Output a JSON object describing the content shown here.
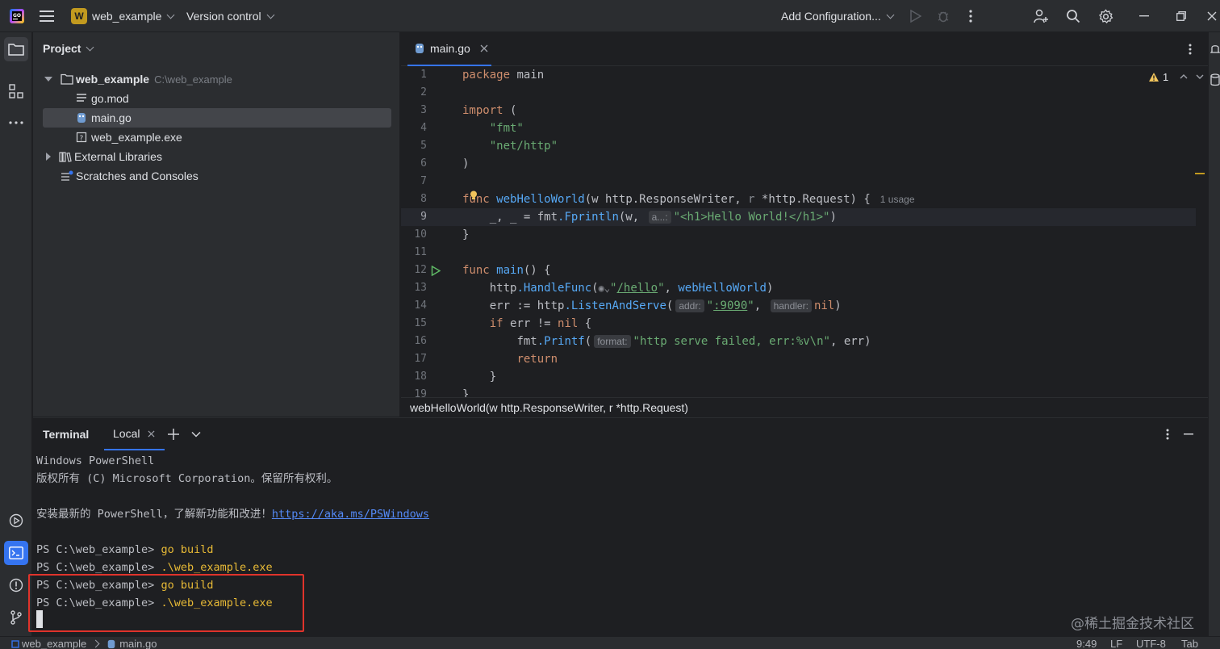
{
  "titlebar": {
    "project_initial": "W",
    "project_name": "web_example",
    "version_control": "Version control",
    "run_config": "Add Configuration..."
  },
  "project_panel": {
    "title": "Project",
    "root_name": "web_example",
    "root_path": "C:\\web_example",
    "files": [
      "go.mod",
      "main.go",
      "web_example.exe"
    ],
    "external_libraries": "External Libraries",
    "scratches": "Scratches and Consoles"
  },
  "editor": {
    "tab_label": "main.go",
    "warning_count": "1",
    "line_numbers": [
      "1",
      "2",
      "3",
      "4",
      "5",
      "6",
      "7",
      "8",
      "9",
      "10",
      "11",
      "12",
      "13",
      "14",
      "15",
      "16",
      "17",
      "18",
      "19"
    ],
    "current_line": "9",
    "breadcrumb": "webHelloWorld(w http.ResponseWriter, r *http.Request)",
    "code": {
      "l1_kw": "package",
      "l1_name": "main",
      "l3_kw": "import",
      "l3_paren": "(",
      "l4_str": "\"fmt\"",
      "l5_str": "\"net/http\"",
      "l6_paren": ")",
      "l8_kw": "func",
      "l8_fn": "webHelloWorld",
      "l8_sig1": "(w ",
      "l8_pkg1": "http",
      "l8_ty1": ".ResponseWriter",
      "l8_sig2": ", ",
      "l8_r": "r",
      "l8_sig3": " *",
      "l8_pkg2": "http",
      "l8_ty2": ".Request",
      "l8_sig4": ") {",
      "l8_usage": "1 usage",
      "l9_pre": "    _, _ = ",
      "l9_pkg": "fmt",
      "l9_call": ".Fprintln",
      "l9_args": "(w, ",
      "l9_hint": "a...:",
      "l9_str": "\"<h1>Hello World!</h1>\"",
      "l9_end": ")",
      "l10": "}",
      "l12_kw": "func",
      "l12_fn": "main",
      "l12_rest": "() {",
      "l13_pre": "    ",
      "l13_pkg": "http",
      "l13_call": ".HandleFunc",
      "l13_open": "(",
      "l13_hint": "◉⌄",
      "l13_str_q1": "\"",
      "l13_str": "/hello",
      "l13_str_q2": "\"",
      "l13_sep": ", ",
      "l13_fn": "webHelloWorld",
      "l13_end": ")",
      "l14_pre": "    err := ",
      "l14_pkg": "http",
      "l14_call": ".ListenAndServe",
      "l14_open": "(",
      "l14_hint1": "addr:",
      "l14_str_q1": "\"",
      "l14_str": ":9090",
      "l14_str_q2": "\"",
      "l14_sep": ", ",
      "l14_hint2": "handler:",
      "l14_nil": "nil",
      "l14_end": ")",
      "l15_pre": "    ",
      "l15_kw": "if",
      "l15_mid": " err != ",
      "l15_nil": "nil",
      "l15_end": " {",
      "l16_pre": "        ",
      "l16_pkg": "fmt",
      "l16_call": ".Printf",
      "l16_open": "(",
      "l16_hint": "format:",
      "l16_str": "\"http serve failed, err:%v\\n\"",
      "l16_end": ", err)",
      "l17_pre": "        ",
      "l17_kw": "return",
      "l18": "    }",
      "l19": "}"
    }
  },
  "terminal": {
    "title": "Terminal",
    "tab_local": "Local",
    "lines": {
      "l1": "Windows PowerShell",
      "l2": "版权所有 (C) Microsoft Corporation。保留所有权利。",
      "l4_text": "安装最新的 PowerShell，了解新功能和改进！",
      "l4_url": "https://aka.ms/PSWindows",
      "prompt": "PS C:\\web_example> ",
      "cmd_build": "go build",
      "cmd_run": ".\\web_example.exe"
    }
  },
  "statusbar": {
    "project": "web_example",
    "file": "main.go",
    "time": "9:49",
    "line_sep": "LF",
    "encoding": "UTF-8",
    "indent": "Tab"
  },
  "watermark": "@稀土掘金技术社区",
  "colors": {
    "accent": "#3574f0",
    "highlight_box": "#e0332b",
    "project_badge": "#c29a1f"
  }
}
